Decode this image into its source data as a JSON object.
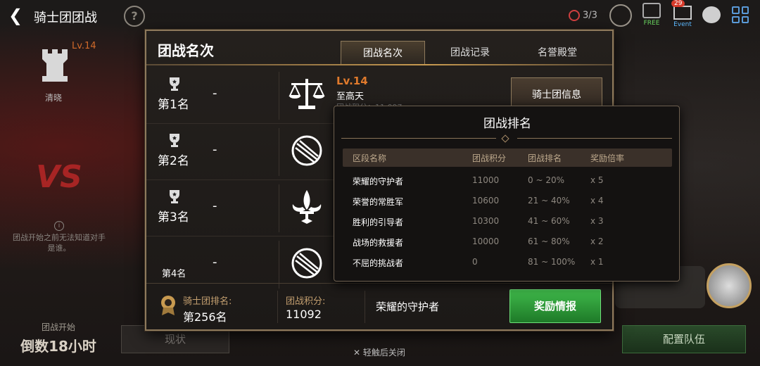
{
  "topbar": {
    "title": "骑士团团战",
    "help": "?",
    "energy": "3/3",
    "free_label": "FREE",
    "event_label": "Event",
    "event_badge": "29"
  },
  "left_panel": {
    "level": "Lv.14",
    "clan_name": "清晓",
    "warning": "团战开始之前无法知道对手是谁。",
    "countdown_label": "团战开始",
    "countdown_value": "倒数18小时"
  },
  "bottom_bar": {
    "status_label": "现状",
    "team_label": "配置队伍"
  },
  "modal": {
    "title": "团战名次",
    "tabs": [
      {
        "label": "团战名次",
        "active": true
      },
      {
        "label": "团战记录",
        "active": false
      },
      {
        "label": "名誉殿堂",
        "active": false
      }
    ],
    "rows": [
      {
        "rank": "第1名",
        "value": "-",
        "emblem": "scales-icon",
        "level": "Lv.14",
        "name": "至高天",
        "score": "团战积分：11,097",
        "button": "骑士团信息"
      },
      {
        "rank": "第2名",
        "value": "-",
        "emblem": "circle-crest-icon"
      },
      {
        "rank": "第3名",
        "value": "-",
        "emblem": "fleur-de-lis-icon"
      },
      {
        "rank": "第4名",
        "value": "-",
        "emblem": "circle-crest-icon"
      }
    ],
    "footer": {
      "clan_rank_label": "骑士团排名:",
      "clan_rank_value": "第256名",
      "score_label": "团战积分:",
      "score_value": "11092",
      "tier": "荣耀的守护者",
      "reward_button": "奖励情报"
    }
  },
  "popup": {
    "title": "团战排名",
    "headers": [
      "区段名称",
      "团战积分",
      "团战排名",
      "奖励倍率"
    ],
    "rows": [
      [
        "荣耀的守护者",
        "11000",
        "0 ~ 20%",
        "x 5"
      ],
      [
        "荣誉的常胜军",
        "10600",
        "21 ~ 40%",
        "x 4"
      ],
      [
        "胜利的引导者",
        "10300",
        "41 ~ 60%",
        "x 3"
      ],
      [
        "战场的救援者",
        "10000",
        "61 ~ 80%",
        "x 2"
      ],
      [
        "不屈的挑战者",
        "0",
        "81 ~ 100%",
        "x 1"
      ]
    ]
  },
  "close_hint": "✕ 轻触后关闭",
  "colors": {
    "accent_gold": "#8e7a5c",
    "level_orange": "#e07a2c",
    "reward_green": "#3fb84a"
  }
}
